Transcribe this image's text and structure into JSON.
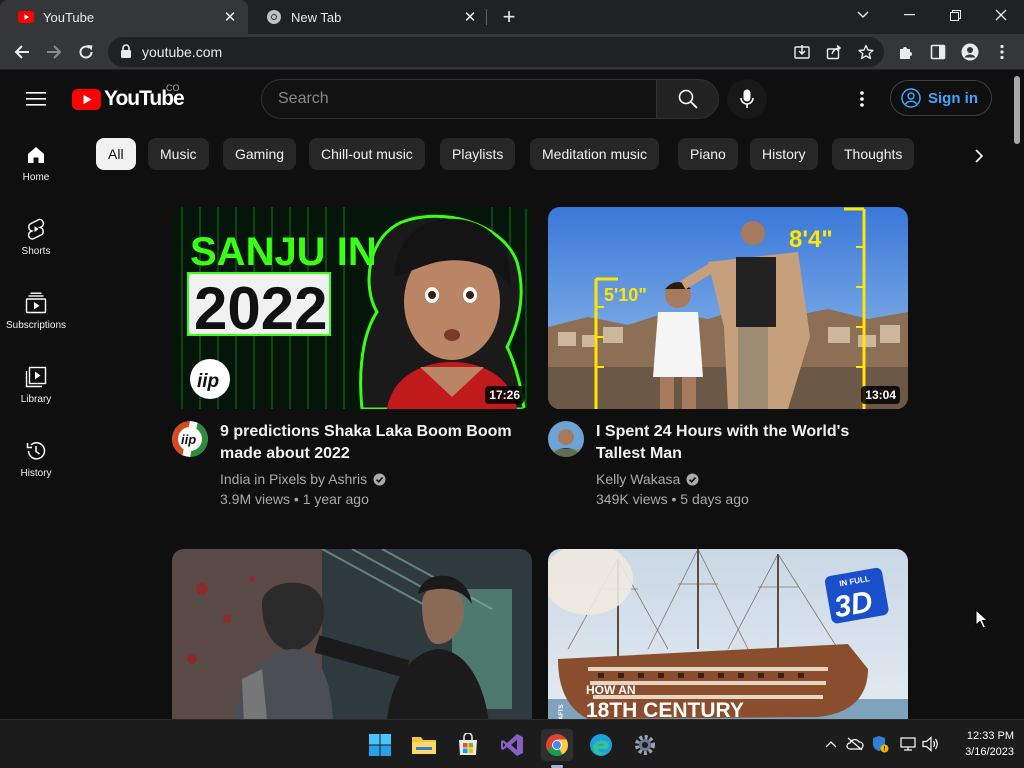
{
  "browser": {
    "tabs": [
      {
        "title": "YouTube",
        "active": true
      },
      {
        "title": "New Tab",
        "active": false
      }
    ],
    "url": "youtube.com"
  },
  "youtube": {
    "logo_text": "YouTube",
    "country_code": "CO",
    "search_placeholder": "Search",
    "sign_in_label": "Sign in",
    "guide": [
      {
        "label": "Home",
        "icon": "home-icon"
      },
      {
        "label": "Shorts",
        "icon": "shorts-icon"
      },
      {
        "label": "Subscriptions",
        "icon": "subscriptions-icon"
      },
      {
        "label": "Library",
        "icon": "library-icon"
      },
      {
        "label": "History",
        "icon": "history-icon"
      }
    ],
    "chips": [
      "All",
      "Music",
      "Gaming",
      "Chill-out music",
      "Playlists",
      "Meditation music",
      "Piano",
      "History",
      "Thoughts"
    ],
    "videos": [
      {
        "title": "9 predictions Shaka Laka Boom Boom made about 2022",
        "channel": "India in Pixels by Ashris",
        "verified": true,
        "views": "3.9M views",
        "age": "1 year ago",
        "duration": "17:26",
        "thumb_text": [
          "SANJU IN",
          "2022"
        ],
        "thumb_logo": "iip"
      },
      {
        "title": "I Spent 24 Hours with the World's Tallest Man",
        "channel": "Kelly Wakasa",
        "verified": true,
        "views": "349K views",
        "age": "5 days ago",
        "duration": "13:04",
        "thumb_text": [
          "8'4\"",
          "5'10\""
        ]
      },
      {
        "title": "",
        "channel": "",
        "thumb_text": []
      },
      {
        "title": "",
        "channel": "",
        "thumb_text": [
          "HOW AN",
          "18TH CENTURY",
          "IN FULL",
          "3D",
          "GRAFTS"
        ]
      }
    ]
  },
  "taskbar": {
    "time": "12:33 PM",
    "date": "3/16/2023",
    "apps": [
      "windows-start",
      "file-explorer",
      "microsoft-store",
      "visual-studio",
      "chrome",
      "edge",
      "settings"
    ]
  },
  "colors": {
    "youtube_red": "#ff0000",
    "link_blue": "#3ea6ff",
    "background": "#0f0f0f"
  }
}
